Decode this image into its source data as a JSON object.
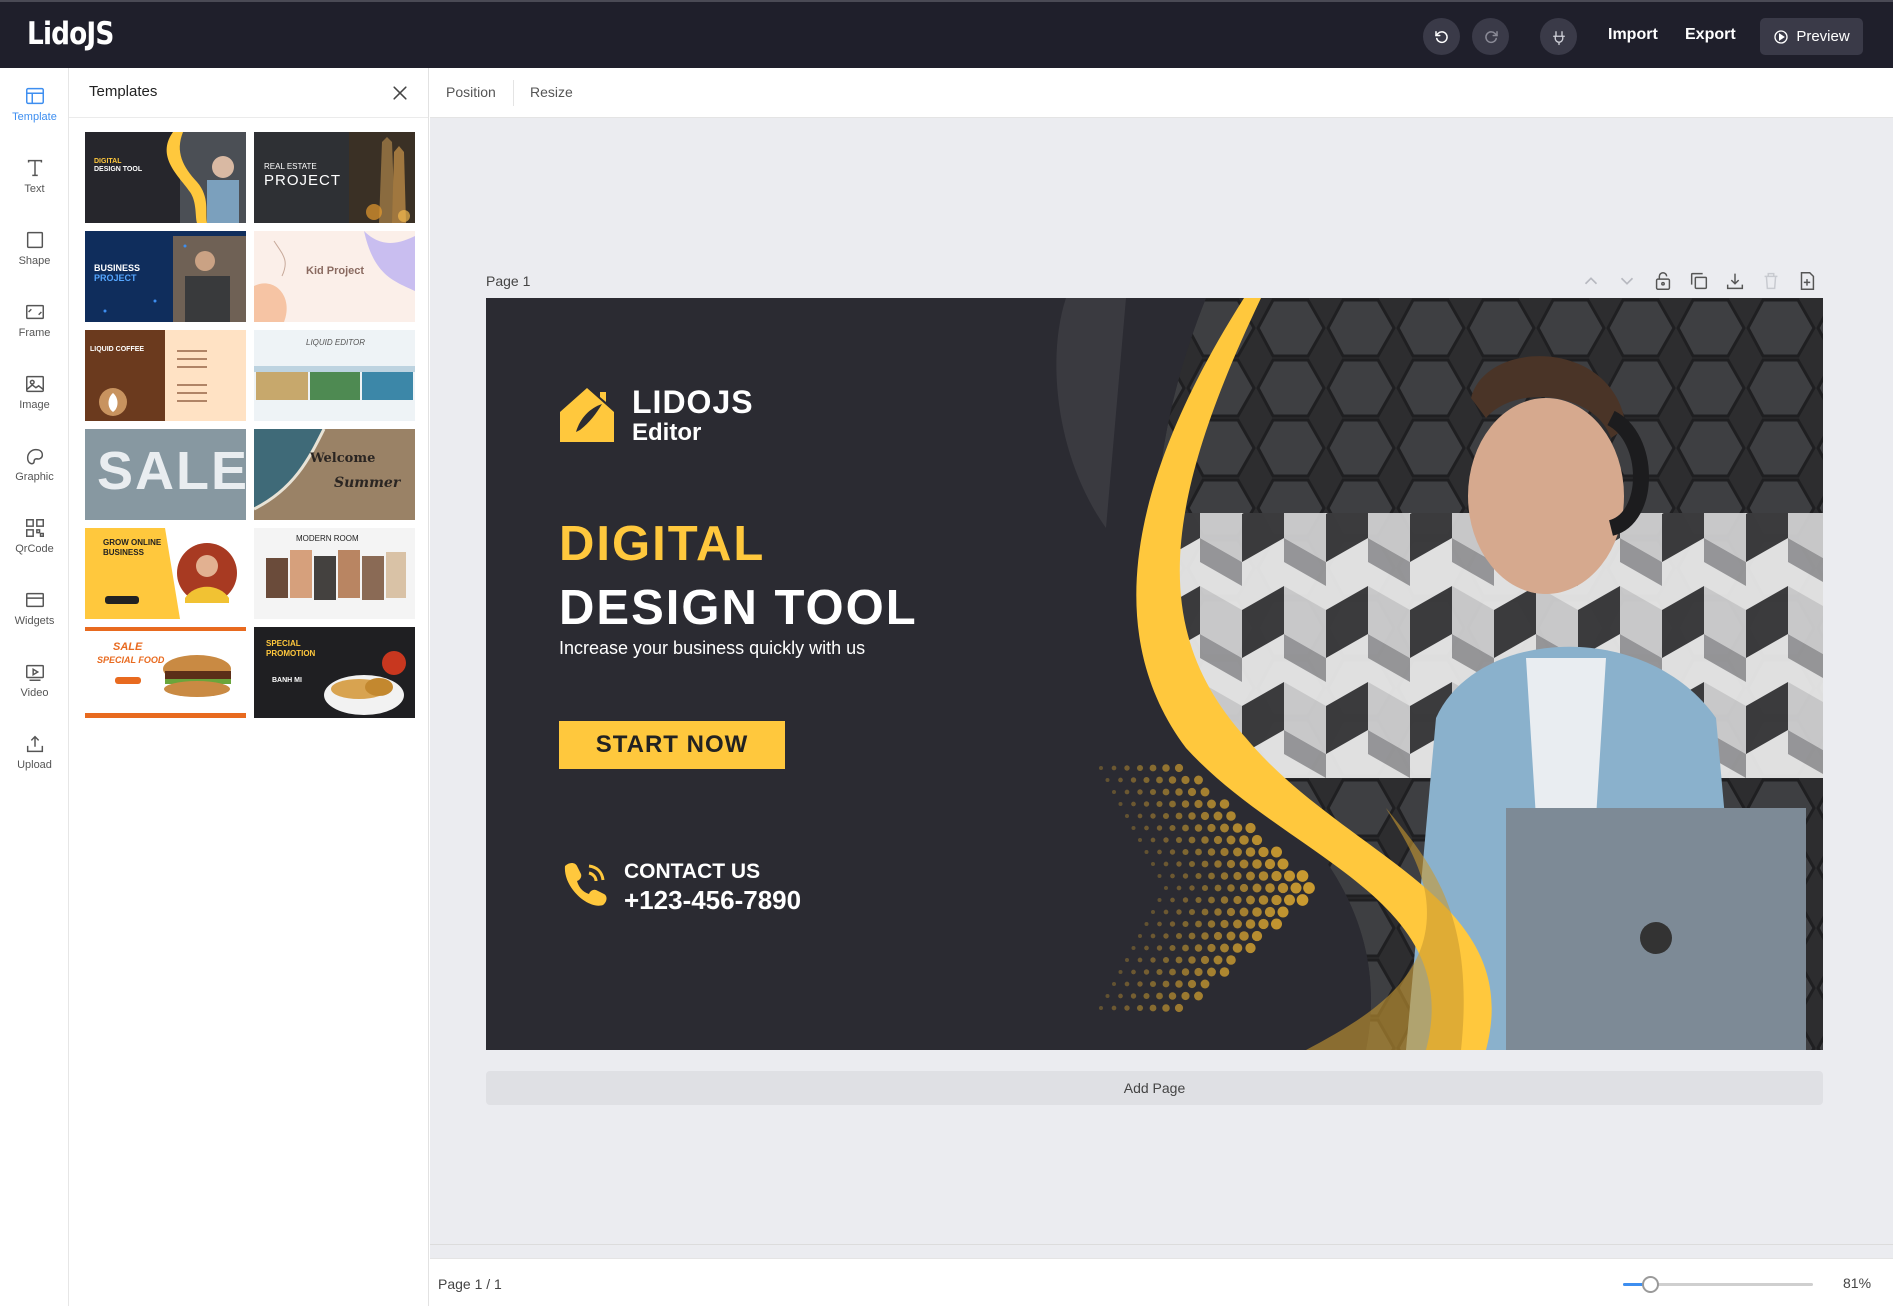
{
  "app": {
    "logo": "LidoJS",
    "import_label": "Import",
    "export_label": "Export",
    "preview_label": "Preview"
  },
  "rail": [
    {
      "label": "Template",
      "icon": "template-icon",
      "active": true
    },
    {
      "label": "Text",
      "icon": "text-icon"
    },
    {
      "label": "Shape",
      "icon": "shape-icon"
    },
    {
      "label": "Frame",
      "icon": "frame-icon"
    },
    {
      "label": "Image",
      "icon": "image-icon"
    },
    {
      "label": "Graphic",
      "icon": "graphic-icon"
    },
    {
      "label": "QrCode",
      "icon": "qrcode-icon"
    },
    {
      "label": "Widgets",
      "icon": "widgets-icon"
    },
    {
      "label": "Video",
      "icon": "video-icon"
    },
    {
      "label": "Upload",
      "icon": "upload-icon"
    }
  ],
  "panel": {
    "title": "Templates",
    "thumbnails": [
      {
        "lines": [
          "DIGITAL",
          "DESIGN TOOL"
        ],
        "theme": "dark-yellow"
      },
      {
        "lines": [
          "REAL ESTATE",
          "PROJECT"
        ],
        "theme": "night-city"
      },
      {
        "lines": [
          "BUSINESS",
          "PROJECT"
        ],
        "theme": "navy"
      },
      {
        "lines": [
          "Kid Project"
        ],
        "theme": "pastel"
      },
      {
        "lines": [
          "LIQUID COFFEE"
        ],
        "theme": "coffee"
      },
      {
        "lines": [
          "LIQUID EDITOR"
        ],
        "theme": "travel"
      },
      {
        "lines": [
          "SALE"
        ],
        "theme": "sale"
      },
      {
        "lines": [
          "Welcome",
          "Summer"
        ],
        "theme": "beach"
      },
      {
        "lines": [
          "GROW ONLINE",
          "BUSINESS"
        ],
        "theme": "yellow"
      },
      {
        "lines": [
          "MODERN ROOM"
        ],
        "theme": "fashion"
      },
      {
        "lines": [
          "SALE",
          "SPECIAL FOOD"
        ],
        "theme": "food-white"
      },
      {
        "lines": [
          "SPECIAL",
          "PROMOTION",
          "BANH MI"
        ],
        "theme": "food-dark"
      }
    ]
  },
  "toolbar": {
    "position_label": "Position",
    "resize_label": "Resize"
  },
  "canvas": {
    "page_label": "Page 1",
    "add_page_label": "Add Page",
    "design": {
      "brand_name": "LIDOJS",
      "brand_sub": "Editor",
      "headline_1": "DIGITAL",
      "headline_2": "DESIGN TOOL",
      "tagline": "Increase your business quickly with us",
      "cta": "START NOW",
      "contact_title": "CONTACT US",
      "contact_phone": "+123-456-7890"
    }
  },
  "footer": {
    "page_indicator": "Page 1 / 1",
    "zoom_label": "81%",
    "zoom_fraction": 0.14
  },
  "colors": {
    "accent": "#3d8ef0",
    "topbar": "#1f1f2b",
    "design_bg": "#2b2b32",
    "design_yellow": "#ffc83d"
  }
}
